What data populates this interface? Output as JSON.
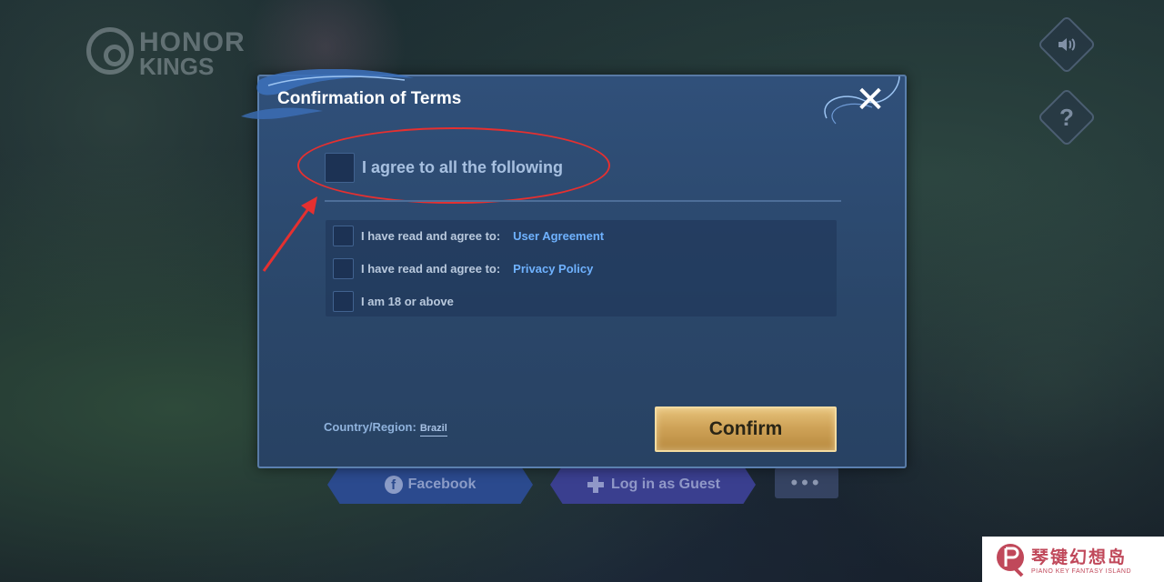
{
  "background": {
    "logo": {
      "line1": "HONOR",
      "line2": "KINGS"
    },
    "side_buttons": [
      {
        "icon": "speaker-icon",
        "glyph": "🔊"
      },
      {
        "icon": "question-icon",
        "glyph": "?"
      }
    ],
    "login": {
      "facebook_label": "Facebook",
      "guest_label": "Log in as Guest",
      "more_label": "•••"
    }
  },
  "modal": {
    "title": "Confirmation of Terms",
    "close_glyph": "✕",
    "agree_all_label": "I agree to all the following",
    "terms": [
      {
        "text": "I have read and agree to:",
        "link": "User Agreement",
        "checked": false
      },
      {
        "text": "I have read and agree to:",
        "link": "Privacy Policy",
        "checked": false
      },
      {
        "text": "I am 18 or above",
        "link": "",
        "checked": false
      }
    ],
    "country_label": "Country/Region:",
    "country_value": "Brazil",
    "confirm_label": "Confirm"
  },
  "watermark": {
    "cn": "琴键幻想岛",
    "en": "PIANO KEY FANTASY ISLAND"
  },
  "colors": {
    "annotation": "#e53030",
    "link": "#6fb2ff",
    "confirm_gold": "#cfa358",
    "modal_bg": "#2a4669"
  }
}
